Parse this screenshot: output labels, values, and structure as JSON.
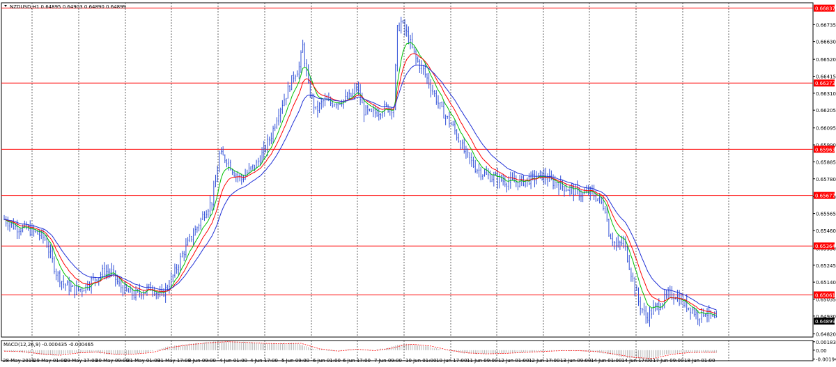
{
  "chart_data": {
    "type": "candlestick",
    "symbol_header": "NZDUSD,H1  0.64895 0.64903 0.64890 0.64899",
    "colors": {
      "candles": "#2f4fd6",
      "ma_fast": "#00c000",
      "ma_mid": "#ff0000",
      "ma_slow": "#1f2fd6",
      "levels": "#ff0000",
      "grid": "#000000",
      "macd_hist": "#a8a8a8",
      "macd_signal": "#ff0000",
      "current_price_box": "#000000"
    },
    "y_ticks": [
      "0.66735",
      "0.66630",
      "0.66520",
      "0.66415",
      "0.66310",
      "0.66205",
      "0.66095",
      "0.65990",
      "0.65885",
      "0.65780",
      "0.65670",
      "0.65565",
      "0.65460",
      "0.65350",
      "0.65245",
      "0.65140",
      "0.65035",
      "0.64930",
      "0.64820"
    ],
    "ylim": [
      0.648,
      0.6687
    ],
    "horizontal_levels": [
      0.66837,
      0.66373,
      0.65963,
      0.65677,
      0.65364,
      0.65061
    ],
    "level_labels": [
      "0.66837",
      "0.66373",
      "0.65963",
      "0.65677",
      "0.65364",
      "0.65061"
    ],
    "current_price": 0.64899,
    "current_price_label": "0.64899",
    "x_labels": [
      "28 May 2019",
      "29 May 01:00",
      "29 May 17:00",
      "30 May 09:00",
      "31 May 01:00",
      "31 May 17:00",
      "3 Jun 09:00",
      "4 Jun 01:00",
      "4 Jun 17:00",
      "5 Jun 09:00",
      "6 Jun 01:00",
      "6 Jun 17:00",
      "7 Jun 09:00",
      "10 Jun 01:00",
      "10 Jun 17:00",
      "11 Jun 09:00",
      "12 Jun 01:00",
      "12 Jun 17:00",
      "13 Jun 09:00",
      "14 Jun 01:00",
      "14 Jun 17:00",
      "17 Jun 09:00",
      "18 Jun 01:00"
    ],
    "price_path": [
      [
        0,
        0.6553
      ],
      [
        6,
        0.6548
      ],
      [
        12,
        0.6547
      ],
      [
        18,
        0.6544
      ],
      [
        22,
        0.6541
      ],
      [
        28,
        0.652
      ],
      [
        32,
        0.6513
      ],
      [
        38,
        0.6509
      ],
      [
        42,
        0.651
      ],
      [
        46,
        0.6514
      ],
      [
        50,
        0.6517
      ],
      [
        54,
        0.6521
      ],
      [
        58,
        0.652
      ],
      [
        62,
        0.6512
      ],
      [
        66,
        0.6508
      ],
      [
        70,
        0.6506
      ],
      [
        76,
        0.6509
      ],
      [
        80,
        0.6511
      ],
      [
        84,
        0.6505
      ],
      [
        88,
        0.6511
      ],
      [
        92,
        0.652
      ],
      [
        96,
        0.6531
      ],
      [
        100,
        0.654
      ],
      [
        104,
        0.6548
      ],
      [
        108,
        0.6557
      ],
      [
        112,
        0.6564
      ],
      [
        114,
        0.6576
      ],
      [
        116,
        0.6593
      ],
      [
        120,
        0.659
      ],
      [
        124,
        0.6582
      ],
      [
        128,
        0.6578
      ],
      [
        132,
        0.6583
      ],
      [
        136,
        0.6587
      ],
      [
        140,
        0.6595
      ],
      [
        144,
        0.6605
      ],
      [
        148,
        0.662
      ],
      [
        152,
        0.663
      ],
      [
        156,
        0.6642
      ],
      [
        159,
        0.6647
      ],
      [
        161,
        0.666
      ],
      [
        164,
        0.6635
      ],
      [
        168,
        0.662
      ],
      [
        172,
        0.6626
      ],
      [
        176,
        0.6625
      ],
      [
        180,
        0.6626
      ],
      [
        184,
        0.6627
      ],
      [
        188,
        0.663
      ],
      [
        190,
        0.6635
      ],
      [
        194,
        0.662
      ],
      [
        198,
        0.6618
      ],
      [
        202,
        0.662
      ],
      [
        206,
        0.6622
      ],
      [
        210,
        0.6622
      ],
      [
        212,
        0.667
      ],
      [
        214,
        0.6675
      ],
      [
        218,
        0.6665
      ],
      [
        222,
        0.6652
      ],
      [
        226,
        0.6645
      ],
      [
        230,
        0.6635
      ],
      [
        236,
        0.662
      ],
      [
        242,
        0.661
      ],
      [
        248,
        0.6595
      ],
      [
        254,
        0.6585
      ],
      [
        260,
        0.658
      ],
      [
        266,
        0.6578
      ],
      [
        272,
        0.6576
      ],
      [
        278,
        0.6576
      ],
      [
        284,
        0.6578
      ],
      [
        290,
        0.658
      ],
      [
        296,
        0.6576
      ],
      [
        302,
        0.6573
      ],
      [
        308,
        0.657
      ],
      [
        312,
        0.6568
      ],
      [
        316,
        0.657
      ],
      [
        320,
        0.6566
      ],
      [
        324,
        0.656
      ],
      [
        326,
        0.6545
      ],
      [
        330,
        0.6536
      ],
      [
        334,
        0.6539
      ],
      [
        338,
        0.652
      ],
      [
        342,
        0.6502
      ],
      [
        346,
        0.6492
      ],
      [
        350,
        0.6497
      ],
      [
        354,
        0.6501
      ],
      [
        358,
        0.6506
      ],
      [
        362,
        0.6506
      ],
      [
        366,
        0.6501
      ],
      [
        370,
        0.6498
      ],
      [
        374,
        0.6493
      ],
      [
        378,
        0.6496
      ],
      [
        382,
        0.6491
      ],
      [
        384,
        0.64899
      ]
    ],
    "macd_label": "MACD(12,26,9) -0.000435 -0.000465",
    "macd_ticks": [
      "0.001833",
      "0.00",
      "-0.001942"
    ],
    "macd_ylim": [
      -0.0023,
      0.0021
    ],
    "macd_signal_path": [
      [
        0,
        -0.0002
      ],
      [
        10,
        -0.0003
      ],
      [
        20,
        -0.0008
      ],
      [
        30,
        -0.0011
      ],
      [
        40,
        -0.0006
      ],
      [
        50,
        -0.0004
      ],
      [
        60,
        -0.0009
      ],
      [
        70,
        -0.00085
      ],
      [
        80,
        -0.0005
      ],
      [
        90,
        0.0006
      ],
      [
        100,
        0.0012
      ],
      [
        110,
        0.0016
      ],
      [
        120,
        0.00185
      ],
      [
        130,
        0.0017
      ],
      [
        140,
        0.0015
      ],
      [
        150,
        0.0014
      ],
      [
        160,
        0.0015
      ],
      [
        170,
        0.0003
      ],
      [
        180,
        -0.0002
      ],
      [
        190,
        0.0002
      ],
      [
        200,
        -0.0001
      ],
      [
        210,
        0.0005
      ],
      [
        215,
        0.0011
      ],
      [
        220,
        0.0013
      ],
      [
        230,
        0.0009
      ],
      [
        240,
        0.0
      ],
      [
        250,
        -0.0006
      ],
      [
        260,
        -0.0008
      ],
      [
        270,
        -0.0007
      ],
      [
        280,
        -0.0005
      ],
      [
        290,
        -0.0003
      ],
      [
        300,
        -0.0001
      ],
      [
        310,
        -0.0001
      ],
      [
        320,
        -0.0003
      ],
      [
        330,
        -0.0009
      ],
      [
        340,
        -0.0016
      ],
      [
        350,
        -0.0018
      ],
      [
        360,
        -0.0009
      ],
      [
        370,
        -0.0005
      ],
      [
        380,
        -0.00045
      ],
      [
        384,
        -0.00046
      ]
    ]
  }
}
